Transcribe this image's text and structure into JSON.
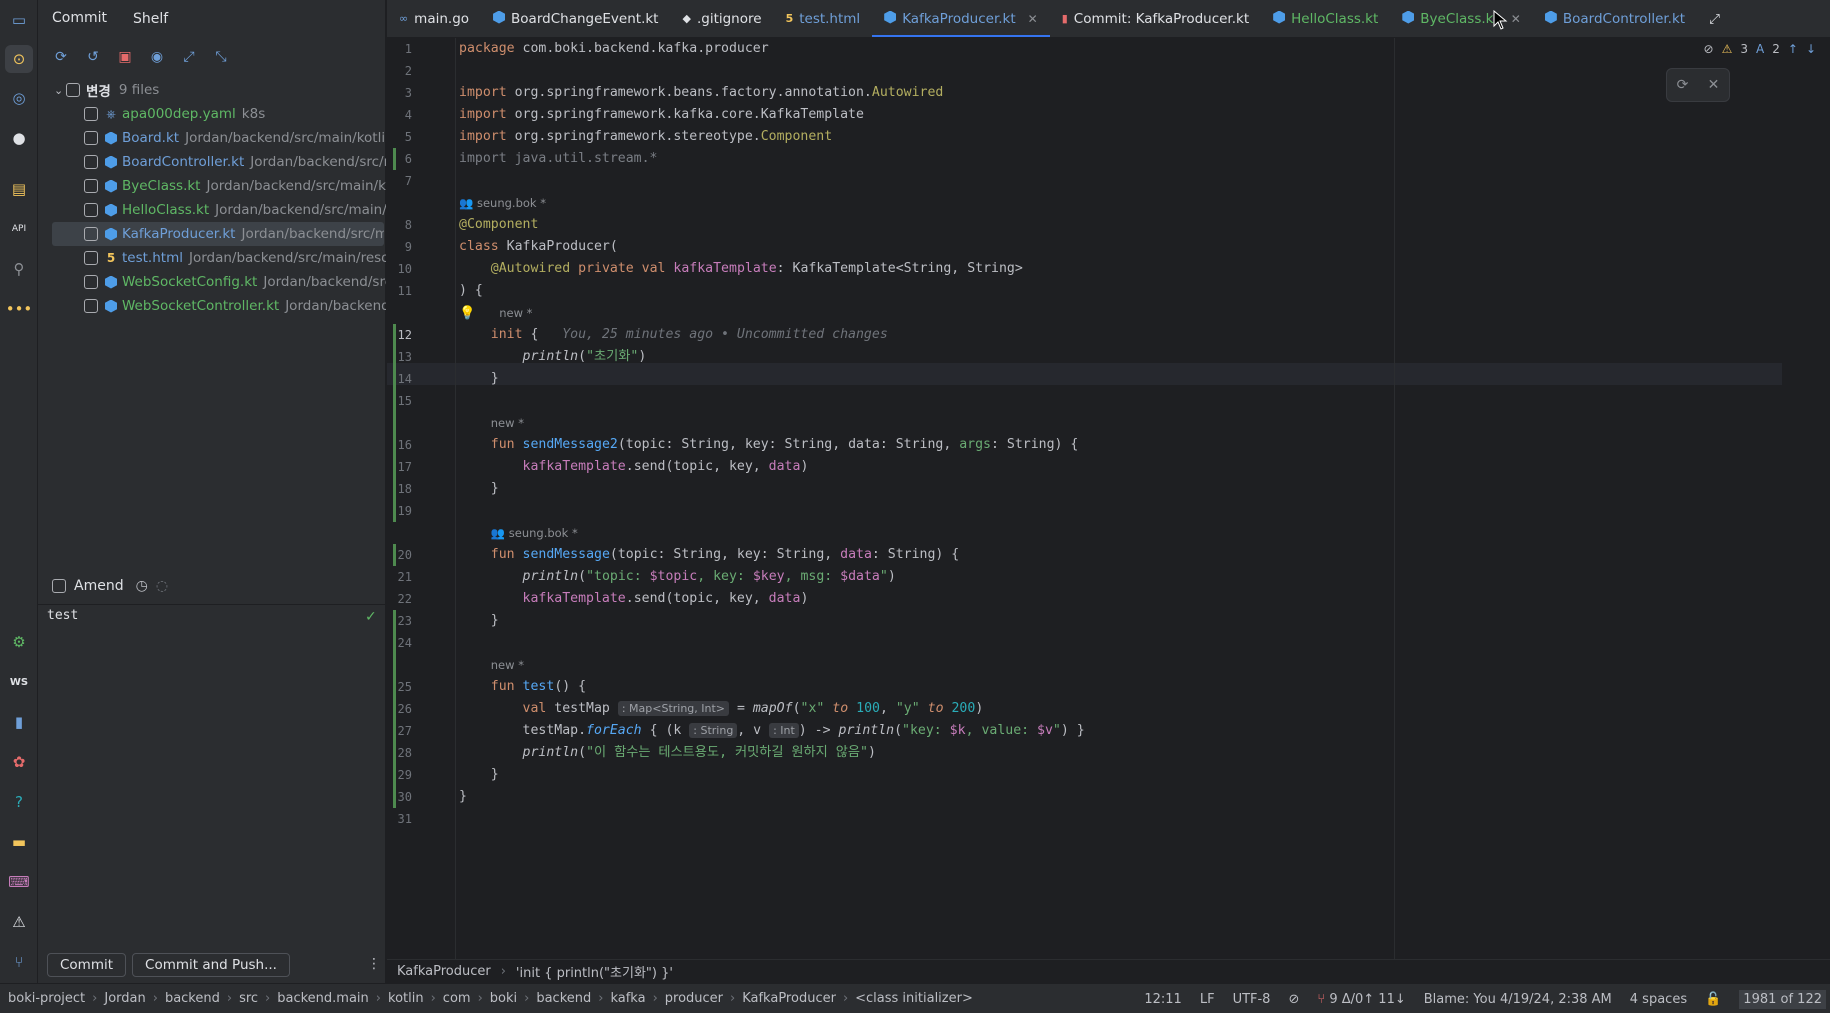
{
  "panel": {
    "tabs": [
      "Commit",
      "Shelf"
    ],
    "group": {
      "label": "변경",
      "count": "9 files"
    },
    "files": [
      {
        "name": "apa000dep.yaml",
        "path": "k8s",
        "color": "#5fb865",
        "icon": "k8s-icon"
      },
      {
        "name": "Board.kt",
        "path": "Jordan/backend/src/main/kotlin/",
        "color": "#6f9fd8",
        "icon": "kotlin-class-icon"
      },
      {
        "name": "BoardController.kt",
        "path": "Jordan/backend/src/m",
        "color": "#6f9fd8",
        "icon": "kotlin-class-icon"
      },
      {
        "name": "ByeClass.kt",
        "path": "Jordan/backend/src/main/ko",
        "color": "#5fb865",
        "icon": "kotlin-class-icon"
      },
      {
        "name": "HelloClass.kt",
        "path": "Jordan/backend/src/main/k",
        "color": "#5fb865",
        "icon": "kotlin-class-icon"
      },
      {
        "name": "KafkaProducer.kt",
        "path": "Jordan/backend/src/ma",
        "color": "#6f9fd8",
        "icon": "kotlin-class-icon"
      },
      {
        "name": "test.html",
        "path": "Jordan/backend/src/main/resou",
        "color": "#6f9fd8",
        "icon": "html-icon"
      },
      {
        "name": "WebSocketConfig.kt",
        "path": "Jordan/backend/src",
        "color": "#5fb865",
        "icon": "kotlin-class-icon"
      },
      {
        "name": "WebSocketController.kt",
        "path": "Jordan/backend/",
        "color": "#5fb865",
        "icon": "kotlin-class-icon"
      }
    ],
    "amend_label": "Amend",
    "commit_message": "test",
    "commit_button": "Commit",
    "commit_push_button": "Commit and Push..."
  },
  "tabs": [
    {
      "label": "main.go",
      "color": "#dfe1e5",
      "icon": "go-icon"
    },
    {
      "label": "BoardChangeEvent.kt",
      "color": "#dfe1e5",
      "icon": "kotlin-class-icon"
    },
    {
      "label": ".gitignore",
      "color": "#dfe1e5",
      "icon": "git-icon"
    },
    {
      "label": "test.html",
      "color": "#6f9fd8",
      "icon": "html-icon"
    },
    {
      "label": "KafkaProducer.kt",
      "color": "#6f9fd8",
      "icon": "kotlin-class-icon",
      "active": true
    },
    {
      "label": "Commit: KafkaProducer.kt",
      "color": "#dfe1e5",
      "icon": "diff-icon"
    },
    {
      "label": "HelloClass.kt",
      "color": "#5fb865",
      "icon": "kotlin-class-icon"
    },
    {
      "label": "ByeClass.kt",
      "color": "#5fb865",
      "icon": "kotlin-class-icon"
    },
    {
      "label": "BoardController.kt",
      "color": "#6f9fd8",
      "icon": "kotlin-class-icon"
    }
  ],
  "editor": {
    "inspections": {
      "warnings": "3",
      "typos": "2"
    },
    "line_numbers": [
      "1",
      "2",
      "3",
      "4",
      "5",
      "6",
      "7",
      "8",
      "9",
      "10",
      "11",
      "12",
      "13",
      "14",
      "15",
      "16",
      "17",
      "18",
      "19",
      "20",
      "21",
      "22",
      "23",
      "24",
      "25",
      "26",
      "27",
      "28",
      "29",
      "30",
      "31"
    ],
    "author_hints": {
      "seung": "seung.bok *",
      "new": "new *"
    },
    "blame_inline": "You, 25 minutes ago • Uncommitted changes",
    "type_hints": {
      "map": ": Map<String, Int>",
      "k": ": String",
      "v": ": Int"
    }
  },
  "breadcrumb": [
    "KafkaProducer",
    "'init { println(\"초기화\") }'"
  ],
  "status": {
    "nav": [
      "boki-project",
      "Jordan",
      "backend",
      "src",
      "backend.main",
      "kotlin",
      "com",
      "boki",
      "backend",
      "kafka",
      "producer",
      "KafkaProducer",
      "<class initializer>"
    ],
    "position": "12:11",
    "line_sep": "LF",
    "encoding": "UTF-8",
    "vcs": "9 Δ/0↑ 11↓",
    "blame": "Blame: You 4/19/24, 2:38 AM",
    "indent": "4 spaces",
    "memory": "1981 of 122"
  }
}
